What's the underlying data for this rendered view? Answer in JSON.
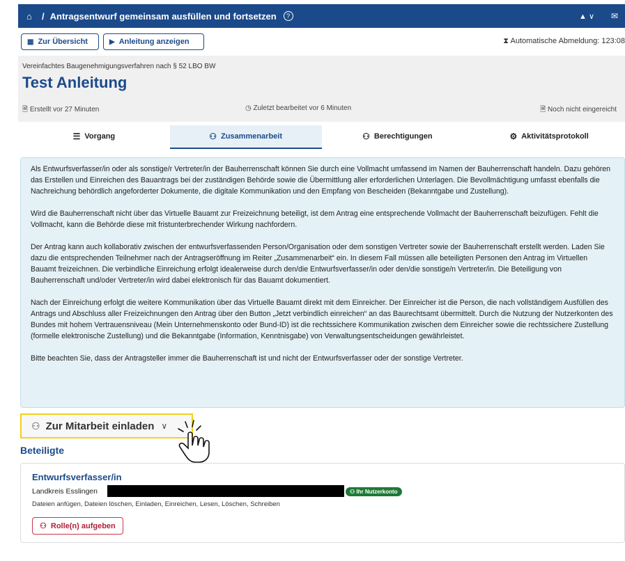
{
  "topbar": {
    "title": "Antragsentwurf gemeinsam ausfüllen und fortsetzen",
    "home_icon": "⌂",
    "separator": "/",
    "help_icon": "?",
    "user_icon": "▲ ∨",
    "mail_icon": "✉"
  },
  "toolbar": {
    "overview_label": "Zur Übersicht",
    "guide_label": "Anleitung anzeigen",
    "logout_text": "Automatische Abmeldung: 123:08"
  },
  "header": {
    "procedure": "Vereinfachtes Baugenehmigungsverfahren nach § 52 LBO BW",
    "name": "Test Anleitung",
    "created": "Erstellt vor 27 Minuten",
    "edited": "Zuletzt bearbeitet vor 6 Minuten",
    "status": "Noch nicht eingereicht"
  },
  "tabs": [
    {
      "label": "Vorgang",
      "icon": "☰"
    },
    {
      "label": "Zusammenarbeit",
      "icon": "⚇"
    },
    {
      "label": "Berechtigungen",
      "icon": "⚇"
    },
    {
      "label": "Aktivitätsprotokoll",
      "icon": "⚙"
    }
  ],
  "info": {
    "p1": "Als Entwurfsverfasser/in oder als sonstige/r Vertreter/in der Bauherrenschaft können Sie durch eine Vollmacht umfassend im Namen der Bauherrenschaft handeln. Dazu gehören das Erstellen und Einreichen des Bauantrags bei der zuständigen Behörde sowie die Übermittlung aller erforderlichen Unterlagen. Die Bevollmächtigung umfasst ebenfalls die Nachreichung behördlich angeforderter Dokumente, die digitale Kommunikation und den Empfang von Bescheiden (Bekanntgabe und Zustellung).",
    "p2": "Wird die Bauherrenschaft nicht über das Virtuelle Bauamt zur Freizeichnung beteiligt, ist dem Antrag eine entsprechende Vollmacht der Bauherrenschaft beizufügen. Fehlt die Vollmacht, kann die Behörde diese mit fristunterbrechender Wirkung nachfordern.",
    "p3": "Der Antrag kann auch kollaborativ zwischen der entwurfsverfassenden Person/Organisation oder dem sonstigen Vertreter sowie der Bauherrenschaft erstellt werden. Laden Sie dazu die entsprechenden Teilnehmer nach der Antragseröffnung im Reiter „Zusammenarbeit“ ein. In diesem Fall müssen alle beteiligten Personen den Antrag im Virtuellen Bauamt freizeichnen. Die verbindliche Einreichung erfolgt idealerweise durch den/die Entwurfsverfasser/in oder den/die sonstige/n Vertreter/in. Die Beteiligung von Bauherrenschaft und/oder Vertreter/in wird dabei elektronisch für das Bauamt dokumentiert.",
    "p4": "Nach der Einreichung erfolgt die weitere Kommunikation über das Virtuelle Bauamt direkt mit dem Einreicher. Der Einreicher ist die Person, die nach vollständigem Ausfüllen des Antrags und Abschluss aller Freizeichnungen den Antrag über den Button „Jetzt verbindlich einreichen“ an das Baurechtsamt übermittelt. Durch die Nutzung der Nutzerkonten des Bundes mit hohem Vertrauensniveau (Mein Unternehmenskonto oder Bund-ID) ist die rechtssichere Kommunikation zwischen dem Einreicher sowie die rechtssichere Zustellung (formelle elektronische Zustellung) und die Bekanntgabe (Information, Kenntnisgabe) von Verwaltungsentscheidungen gewährleistet.",
    "p5": "Bitte beachten Sie, dass der Antragsteller immer die Bauherrenschaft ist und nicht der Entwurfsverfasser oder der sonstige Vertreter."
  },
  "invite": {
    "label": "Zur Mitarbeit einladen"
  },
  "participants": {
    "title": "Beteiligte",
    "entries": [
      {
        "role": "Entwurfsverfasser/in",
        "org": "Landkreis Esslingen",
        "badge": "Ihr Nutzerkonto",
        "permissions": "Dateien anfügen, Dateien löschen, Einladen, Einreichen, Lesen, Löschen, Schreiben",
        "giveup_label": "Rolle(n) aufgeben"
      }
    ]
  }
}
